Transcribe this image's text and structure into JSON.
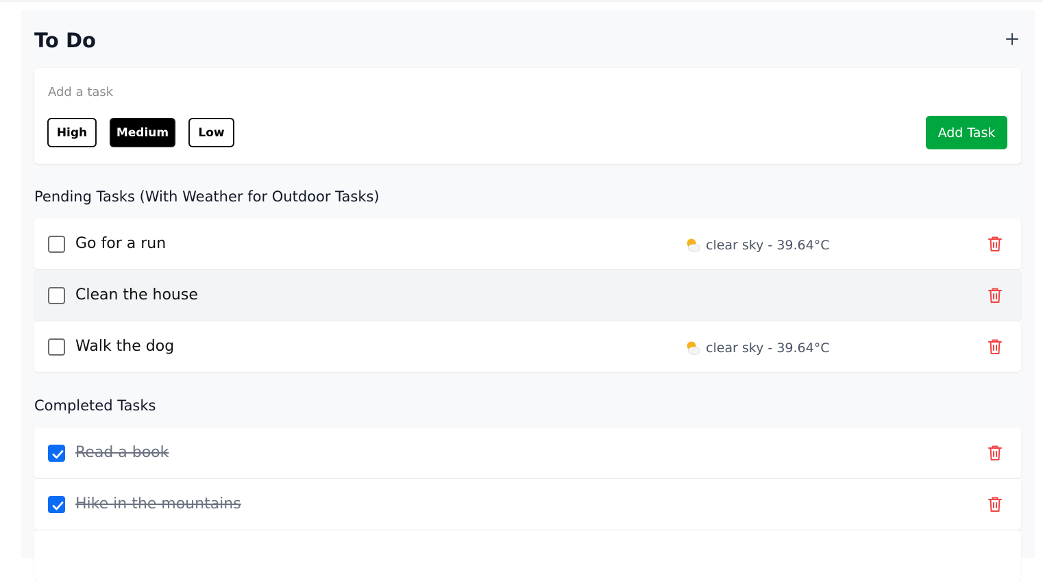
{
  "header": {
    "title": "To Do",
    "add_icon": "plus-icon"
  },
  "new_task": {
    "placeholder": "Add a task",
    "value": "",
    "priorities": [
      {
        "label": "High",
        "selected": false
      },
      {
        "label": "Medium",
        "selected": true
      },
      {
        "label": "Low",
        "selected": false
      }
    ],
    "add_label": "Add Task",
    "add_color": "#00a63e"
  },
  "pending": {
    "heading": "Pending Tasks (With Weather for Outdoor Tasks)",
    "tasks": [
      {
        "text": "Go for a run",
        "weather": "clear sky - 39.64°C",
        "weather_icon": "sun-behind-cloud-icon"
      },
      {
        "text": "Clean the house",
        "weather": ""
      },
      {
        "text": "Walk the dog",
        "weather": "clear sky - 39.64°C",
        "weather_icon": "sun-behind-cloud-icon"
      }
    ]
  },
  "completed": {
    "heading": "Completed Tasks",
    "tasks": [
      {
        "text": "Read a book",
        "checked": true
      },
      {
        "text": "Hike in the mountains",
        "checked": true
      }
    ]
  },
  "colors": {
    "delete": "#ef4444",
    "checkbox_checked": "#0b6cf5",
    "background": "#f8f9fb"
  }
}
